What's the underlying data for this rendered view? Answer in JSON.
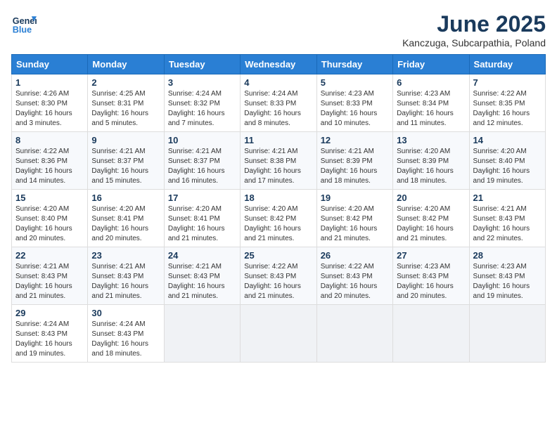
{
  "header": {
    "logo_line1": "General",
    "logo_line2": "Blue",
    "month_title": "June 2025",
    "location": "Kanczuga, Subcarpathia, Poland"
  },
  "days_of_week": [
    "Sunday",
    "Monday",
    "Tuesday",
    "Wednesday",
    "Thursday",
    "Friday",
    "Saturday"
  ],
  "weeks": [
    [
      {
        "day": "1",
        "sunrise": "4:26 AM",
        "sunset": "8:30 PM",
        "daylight": "16 hours and 3 minutes."
      },
      {
        "day": "2",
        "sunrise": "4:25 AM",
        "sunset": "8:31 PM",
        "daylight": "16 hours and 5 minutes."
      },
      {
        "day": "3",
        "sunrise": "4:24 AM",
        "sunset": "8:32 PM",
        "daylight": "16 hours and 7 minutes."
      },
      {
        "day": "4",
        "sunrise": "4:24 AM",
        "sunset": "8:33 PM",
        "daylight": "16 hours and 8 minutes."
      },
      {
        "day": "5",
        "sunrise": "4:23 AM",
        "sunset": "8:33 PM",
        "daylight": "16 hours and 10 minutes."
      },
      {
        "day": "6",
        "sunrise": "4:23 AM",
        "sunset": "8:34 PM",
        "daylight": "16 hours and 11 minutes."
      },
      {
        "day": "7",
        "sunrise": "4:22 AM",
        "sunset": "8:35 PM",
        "daylight": "16 hours and 12 minutes."
      }
    ],
    [
      {
        "day": "8",
        "sunrise": "4:22 AM",
        "sunset": "8:36 PM",
        "daylight": "16 hours and 14 minutes."
      },
      {
        "day": "9",
        "sunrise": "4:21 AM",
        "sunset": "8:37 PM",
        "daylight": "16 hours and 15 minutes."
      },
      {
        "day": "10",
        "sunrise": "4:21 AM",
        "sunset": "8:37 PM",
        "daylight": "16 hours and 16 minutes."
      },
      {
        "day": "11",
        "sunrise": "4:21 AM",
        "sunset": "8:38 PM",
        "daylight": "16 hours and 17 minutes."
      },
      {
        "day": "12",
        "sunrise": "4:21 AM",
        "sunset": "8:39 PM",
        "daylight": "16 hours and 18 minutes."
      },
      {
        "day": "13",
        "sunrise": "4:20 AM",
        "sunset": "8:39 PM",
        "daylight": "16 hours and 18 minutes."
      },
      {
        "day": "14",
        "sunrise": "4:20 AM",
        "sunset": "8:40 PM",
        "daylight": "16 hours and 19 minutes."
      }
    ],
    [
      {
        "day": "15",
        "sunrise": "4:20 AM",
        "sunset": "8:40 PM",
        "daylight": "16 hours and 20 minutes."
      },
      {
        "day": "16",
        "sunrise": "4:20 AM",
        "sunset": "8:41 PM",
        "daylight": "16 hours and 20 minutes."
      },
      {
        "day": "17",
        "sunrise": "4:20 AM",
        "sunset": "8:41 PM",
        "daylight": "16 hours and 21 minutes."
      },
      {
        "day": "18",
        "sunrise": "4:20 AM",
        "sunset": "8:42 PM",
        "daylight": "16 hours and 21 minutes."
      },
      {
        "day": "19",
        "sunrise": "4:20 AM",
        "sunset": "8:42 PM",
        "daylight": "16 hours and 21 minutes."
      },
      {
        "day": "20",
        "sunrise": "4:20 AM",
        "sunset": "8:42 PM",
        "daylight": "16 hours and 21 minutes."
      },
      {
        "day": "21",
        "sunrise": "4:21 AM",
        "sunset": "8:43 PM",
        "daylight": "16 hours and 22 minutes."
      }
    ],
    [
      {
        "day": "22",
        "sunrise": "4:21 AM",
        "sunset": "8:43 PM",
        "daylight": "16 hours and 21 minutes."
      },
      {
        "day": "23",
        "sunrise": "4:21 AM",
        "sunset": "8:43 PM",
        "daylight": "16 hours and 21 minutes."
      },
      {
        "day": "24",
        "sunrise": "4:21 AM",
        "sunset": "8:43 PM",
        "daylight": "16 hours and 21 minutes."
      },
      {
        "day": "25",
        "sunrise": "4:22 AM",
        "sunset": "8:43 PM",
        "daylight": "16 hours and 21 minutes."
      },
      {
        "day": "26",
        "sunrise": "4:22 AM",
        "sunset": "8:43 PM",
        "daylight": "16 hours and 20 minutes."
      },
      {
        "day": "27",
        "sunrise": "4:23 AM",
        "sunset": "8:43 PM",
        "daylight": "16 hours and 20 minutes."
      },
      {
        "day": "28",
        "sunrise": "4:23 AM",
        "sunset": "8:43 PM",
        "daylight": "16 hours and 19 minutes."
      }
    ],
    [
      {
        "day": "29",
        "sunrise": "4:24 AM",
        "sunset": "8:43 PM",
        "daylight": "16 hours and 19 minutes."
      },
      {
        "day": "30",
        "sunrise": "4:24 AM",
        "sunset": "8:43 PM",
        "daylight": "16 hours and 18 minutes."
      },
      null,
      null,
      null,
      null,
      null
    ]
  ]
}
